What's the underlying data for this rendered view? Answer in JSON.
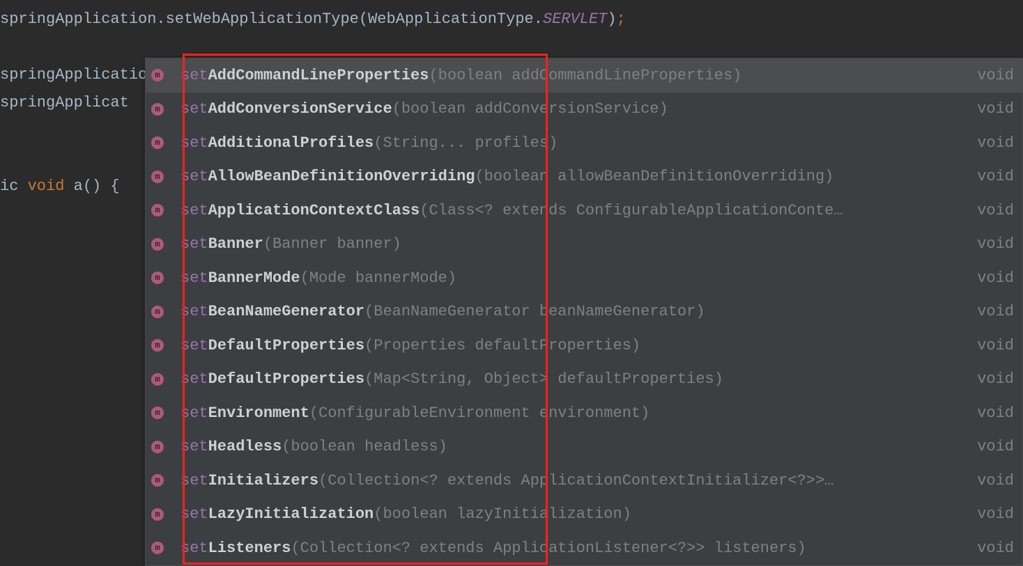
{
  "code": {
    "line1_pre": "springApplication.setWebApplicationType(WebApplicationType.",
    "line1_const": "SERVLET",
    "line1_post": ")",
    "line1_semi": ";",
    "line2": "springApplication.set",
    "line3": "springApplicat",
    "line4_pre": "ic ",
    "line4_kw": "void",
    "line4_post": " a() {"
  },
  "completion": {
    "icon_letter": "m",
    "return_type": "void",
    "items": [
      {
        "prefix": "set",
        "match": "AddCommandLineProperties",
        "params": "(boolean addCommandLineProperties)",
        "selected": true,
        "ellipsis": ""
      },
      {
        "prefix": "set",
        "match": "AddConversionService",
        "params": "(boolean addConversionService)",
        "selected": false,
        "ellipsis": ""
      },
      {
        "prefix": "set",
        "match": "AdditionalProfiles",
        "params": "(String... profiles)",
        "selected": false,
        "ellipsis": ""
      },
      {
        "prefix": "set",
        "match": "AllowBeanDefinitionOverriding",
        "params": "(boolean allowBeanDefinitionOverriding)",
        "selected": false,
        "ellipsis": ""
      },
      {
        "prefix": "set",
        "match": "ApplicationContextClass",
        "params": "(Class<? extends ConfigurableApplicationConte",
        "selected": false,
        "ellipsis": "…"
      },
      {
        "prefix": "set",
        "match": "Banner",
        "params": "(Banner banner)",
        "selected": false,
        "ellipsis": ""
      },
      {
        "prefix": "set",
        "match": "BannerMode",
        "params": "(Mode bannerMode)",
        "selected": false,
        "ellipsis": ""
      },
      {
        "prefix": "set",
        "match": "BeanNameGenerator",
        "params": "(BeanNameGenerator beanNameGenerator)",
        "selected": false,
        "ellipsis": ""
      },
      {
        "prefix": "set",
        "match": "DefaultProperties",
        "params": "(Properties defaultProperties)",
        "selected": false,
        "ellipsis": ""
      },
      {
        "prefix": "set",
        "match": "DefaultProperties",
        "params": "(Map<String, Object> defaultProperties)",
        "selected": false,
        "ellipsis": ""
      },
      {
        "prefix": "set",
        "match": "Environment",
        "params": "(ConfigurableEnvironment environment)",
        "selected": false,
        "ellipsis": ""
      },
      {
        "prefix": "set",
        "match": "Headless",
        "params": "(boolean headless)",
        "selected": false,
        "ellipsis": ""
      },
      {
        "prefix": "set",
        "match": "Initializers",
        "params": "(Collection<? extends ApplicationContextInitializer<?>> ",
        "selected": false,
        "ellipsis": "…"
      },
      {
        "prefix": "set",
        "match": "LazyInitialization",
        "params": "(boolean lazyInitialization)",
        "selected": false,
        "ellipsis": ""
      },
      {
        "prefix": "set",
        "match": "Listeners",
        "params": "(Collection<? extends ApplicationListener<?>> listeners)",
        "selected": false,
        "ellipsis": ""
      }
    ]
  }
}
